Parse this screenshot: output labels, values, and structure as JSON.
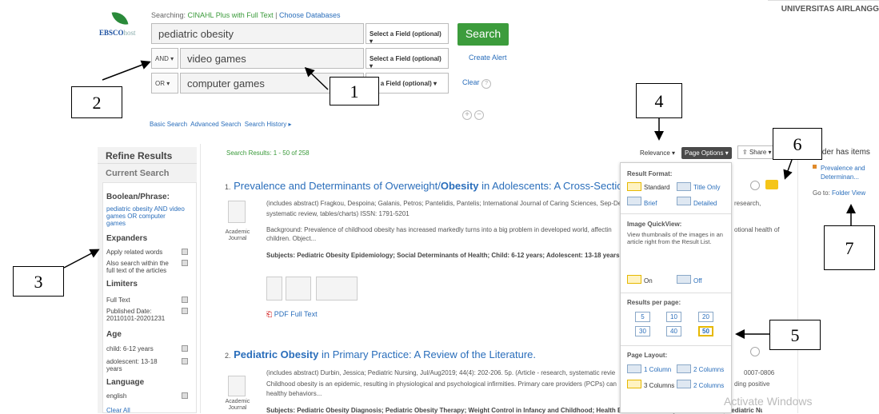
{
  "header": {
    "searching_label": "Searching:",
    "database": "CINAHL Plus with Full Text",
    "choose_db": "Choose Databases",
    "logo_text": "EBSCO",
    "logo_suffix": "host",
    "institution": "UNIVERSITAS AIRLANGG"
  },
  "search": {
    "rows": [
      {
        "bool": "",
        "term": "pediatric obesity",
        "field": "Select a Field (optional) ▾"
      },
      {
        "bool": "AND ▾",
        "term": "video games",
        "field": "Select a Field (optional) ▾"
      },
      {
        "bool": "OR ▾",
        "term": "computer games",
        "field": "ect a Field (optional) ▾"
      }
    ],
    "search_btn": "Search",
    "create_alert": "Create Alert",
    "clear": "Clear",
    "basic": "Basic Search",
    "advanced": "Advanced Search",
    "history": "Search History ▸"
  },
  "annotations": [
    "1",
    "2",
    "3",
    "4",
    "5",
    "6",
    "7"
  ],
  "refine": {
    "title": "Refine Results",
    "current": "Current Search",
    "boolean_h": "Boolean/Phrase:",
    "boolean_v": "pediatric obesity AND video games OR computer games",
    "expanders_h": "Expanders",
    "exp1": "Apply related words",
    "exp2": "Also search within the full text of the articles",
    "limiters_h": "Limiters",
    "lim1": "Full Text",
    "lim2": "Published Date: 20110101-20201231",
    "age_h": "Age",
    "age1": "child: 6-12 years",
    "age2": "adolescent: 13-18 years",
    "lang_h": "Language",
    "lang1": "english",
    "clear_all": "Clear All"
  },
  "results": {
    "summary_label": "Search Results:",
    "summary": "1 - 50 of 258",
    "relevance": "Relevance ▾",
    "page_options": "Page Options ▾",
    "share": "Share ▾",
    "r1_num": "1.",
    "r1_title_a": "Prevalence and Determinants of Overweight/",
    "r1_title_b": "Obesity",
    "r1_title_c": " in Adolescents: A Cross-Sectional Stu",
    "r1_meta": "(includes abstract) Fragkou, Despoina; Galanis, Petros; Pantelidis, Pantelis; International Journal of Caring Sciences, Sep-De",
    "r1_meta2": "systematic review, tables/charts) ISSN: 1791-5201",
    "r1_meta_tail": "research,",
    "r1_abstract": "Background: Prevalence of childhood obesity has increased markedly turns into a big problem in developed world, affectin",
    "r1_abstract2": "children. Object...",
    "r1_abstract_tail": "otional health of",
    "r1_subjects": "Subjects: Pediatric Obesity Epidemiology; Social Determinants of Health; Child: 6-12 years; Adolescent: 13-18 years",
    "r1_type": "Academic Journal",
    "pdf": "PDF Full Text",
    "r2_num": "2.",
    "r2_title_a": "Pediatric Obesity",
    "r2_title_b": " in Primary Practice: A Review of the Literature.",
    "r2_meta": "(includes abstract) Durbin, Jessica; Pediatric Nursing, Jul/Aug2019; 44(4): 202-206. 5p. (Article - research, systematic revie",
    "r2_meta_tail": "0007-0806",
    "r2_abstract": "Childhood obesity is an epidemic, resulting in physiological and psychological infirmities. Primary care providers (PCPs) can",
    "r2_abstract_tail": "ding positive",
    "r2_abstract2": "healthy behaviors...",
    "r2_type": "Academic Journal",
    "r2_subjects": "Subjects: Pediatric Obesity Diagnosis; Pediatric Obesity Therapy; Weight Control in Infancy and Childhood; Health Behavior in Infancy and Childhood; Pediatric Nursing"
  },
  "page_options_panel": {
    "format_h": "Result Format:",
    "standard": "Standard",
    "title_only": "Title Only",
    "brief": "Brief",
    "detailed": "Detailed",
    "quickview_h": "Image QuickView:",
    "quickview_desc": "View thumbnails of the images in an article right from the Result List.",
    "on": "On",
    "off": "Off",
    "per_page_h": "Results per page:",
    "per_page": [
      "5",
      "10",
      "20",
      "30",
      "40",
      "50"
    ],
    "per_page_selected": "50",
    "layout_h": "Page Layout:",
    "col1": "1 Column",
    "col2": "2 Columns",
    "col3": "3 Columns",
    "col2b": "2 Columns"
  },
  "folder": {
    "title": "Folder has items",
    "item": "Prevalence and Determinan...",
    "goto": "Go to:",
    "view": "Folder View"
  },
  "watermark": "Activate Windows"
}
